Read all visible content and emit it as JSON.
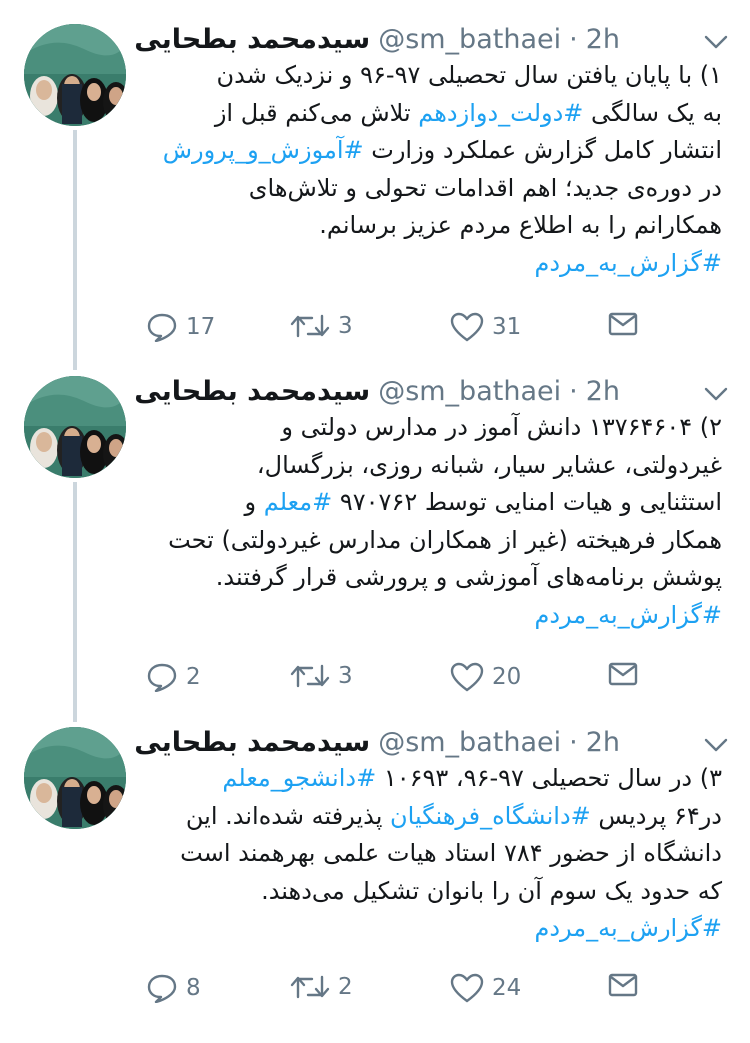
{
  "tweets": [
    {
      "author_name": "سیدمحمد بطحایی",
      "handle": "@sm_bathaei",
      "time": "2h",
      "lines": [
        [
          {
            "t": "۱) با پایان یافتن سال تحصیلی ۹۷-۹۶ و نزدیک شدن"
          }
        ],
        [
          {
            "t": "به یک سالگی "
          },
          {
            "t": "#دولت_دوازدهم",
            "tag": true
          },
          {
            "t": " تلاش می‌کنم قبل از"
          }
        ],
        [
          {
            "t": "انتشار کامل گزارش عملکرد وزارت "
          },
          {
            "t": "#آموزش_و_پرورش",
            "tag": true
          }
        ],
        [
          {
            "t": "در دوره‌ی جدید؛ اهم اقدامات تحولی و تلاش‌های"
          }
        ],
        [
          {
            "t": "همکارانم را به اطلاع مردم عزیز برسانم."
          }
        ],
        [
          {
            "t": "#گزارش_به_مردم",
            "tag": true
          }
        ]
      ],
      "replies": "17",
      "retweets": "3",
      "likes": "31"
    },
    {
      "author_name": "سیدمحمد بطحایی",
      "handle": "@sm_bathaei",
      "time": "2h",
      "lines": [
        [
          {
            "t": "۲) ۱۳۷۶۴۶۰۴ دانش آموز در مدارس دولتی و"
          }
        ],
        [
          {
            "t": "غیردولتی، عشایر سیار، شبانه روزی، بزرگسال،"
          }
        ],
        [
          {
            "t": "استثنایی و هیات امنایی توسط ۹۷۰۷۶۲ "
          },
          {
            "t": "#معلم",
            "tag": true
          },
          {
            "t": " و"
          }
        ],
        [
          {
            "t": "همکار فرهیخته (غیر از همکاران مدارس غیردولتی) تحت"
          }
        ],
        [
          {
            "t": "پوشش برنامه‌های آموزشی و پرورشی قرار گرفتند."
          }
        ],
        [
          {
            "t": "#گزارش_به_مردم",
            "tag": true
          }
        ]
      ],
      "replies": "2",
      "retweets": "3",
      "likes": "20"
    },
    {
      "author_name": "سیدمحمد بطحایی",
      "handle": "@sm_bathaei",
      "time": "2h",
      "lines": [
        [
          {
            "t": "۳) در سال تحصیلی ۹۷-۹۶، ۱۰۶۹۳ "
          },
          {
            "t": "#دانشجو_معلم",
            "tag": true
          }
        ],
        [
          {
            "t": "در۶۴ پردیس "
          },
          {
            "t": "#دانشگاه_فرهنگیان",
            "tag": true
          },
          {
            "t": " پذیرفته شده‌اند. این"
          }
        ],
        [
          {
            "t": "دانشگاه از حضور ۷۸۴ استاد هیات علمی بهرهمند است"
          }
        ],
        [
          {
            "t": "که حدود یک سوم آن را بانوان تشکیل می‌دهند."
          }
        ],
        [
          {
            "t": "#گزارش_به_مردم",
            "tag": true
          }
        ]
      ],
      "replies": "8",
      "retweets": "2",
      "likes": "24"
    }
  ],
  "colors": {
    "link": "#1da1f2",
    "muted": "#657786",
    "thread_line": "#ccd6dd"
  },
  "icons": [
    "reply-icon",
    "retweet-icon",
    "like-icon",
    "message-icon",
    "chevron-down-icon"
  ]
}
